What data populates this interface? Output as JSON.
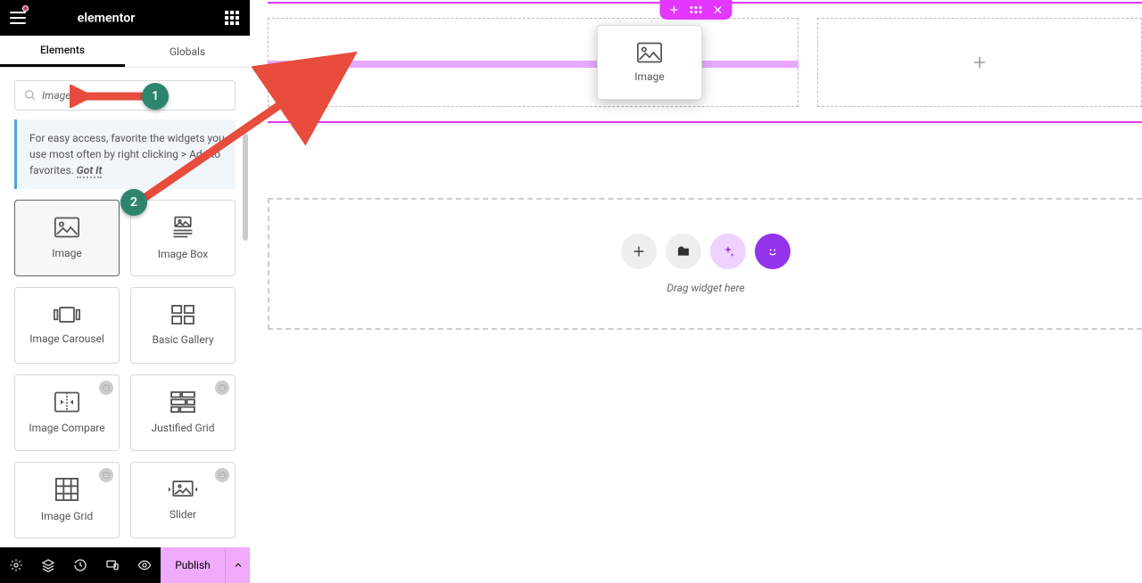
{
  "brand": {
    "name": "elementor"
  },
  "tabs": {
    "elements": "Elements",
    "globals": "Globals"
  },
  "search": {
    "value": "Image"
  },
  "tip": {
    "text": "For easy access, favorite the widgets you use most often by right clicking > Add to favorites.",
    "dismiss": "Got It"
  },
  "widgets": [
    {
      "label": "Image",
      "icon": "image",
      "pro": false,
      "selected": true
    },
    {
      "label": "Image Box",
      "icon": "image-box",
      "pro": false
    },
    {
      "label": "Image Carousel",
      "icon": "carousel",
      "pro": false
    },
    {
      "label": "Basic Gallery",
      "icon": "gallery",
      "pro": false
    },
    {
      "label": "Image Compare",
      "icon": "compare",
      "pro": true
    },
    {
      "label": "Justified Grid",
      "icon": "justified",
      "pro": true
    },
    {
      "label": "Image Grid",
      "icon": "grid",
      "pro": true
    },
    {
      "label": "Slider",
      "icon": "slider",
      "pro": true
    }
  ],
  "drag_preview": {
    "label": "Image"
  },
  "dropzone": {
    "text": "Drag widget here"
  },
  "footer": {
    "publish": "Publish"
  },
  "annotations": {
    "step1": "1",
    "step2": "2"
  }
}
